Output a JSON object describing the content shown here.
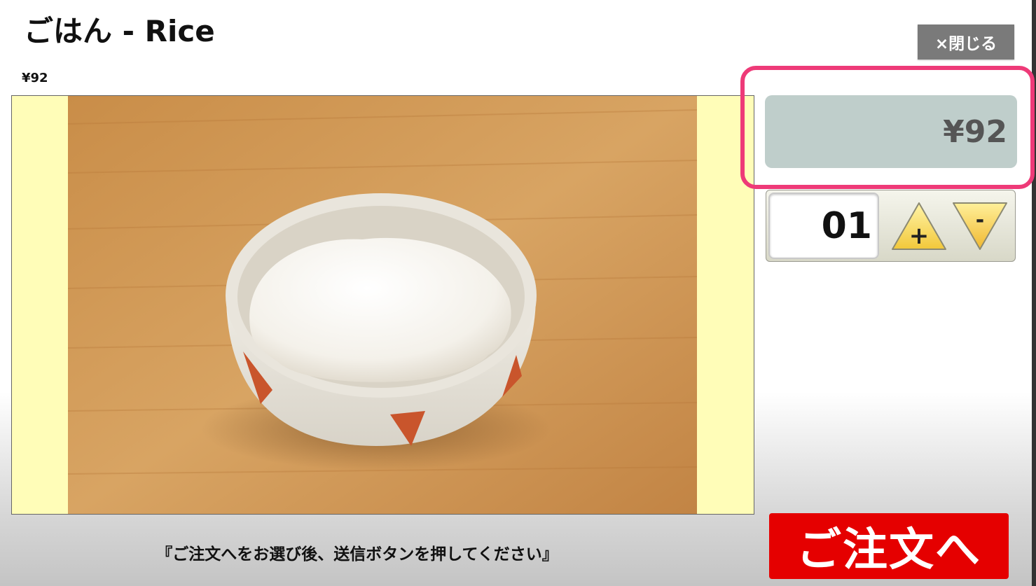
{
  "item": {
    "title": "ごはん - Rice",
    "price": "¥92"
  },
  "close_button": {
    "label": "×閉じる"
  },
  "order_panel": {
    "total": "¥92",
    "quantity": "01",
    "plus_label": "+",
    "minus_label": "-"
  },
  "footer": {
    "instructions": "『ご注文へをお選び後、送信ボタンを押してください』",
    "order_button_label": "ご注文へ"
  },
  "colors": {
    "highlight": "#ee3a78",
    "total_bg": "#bfcecb",
    "order_button": "#e50000",
    "image_letterbox": "#fffdb8",
    "close_button": "#7a7a7a"
  },
  "icons": {
    "plus": "plus-triangle-icon",
    "minus": "minus-triangle-icon"
  }
}
